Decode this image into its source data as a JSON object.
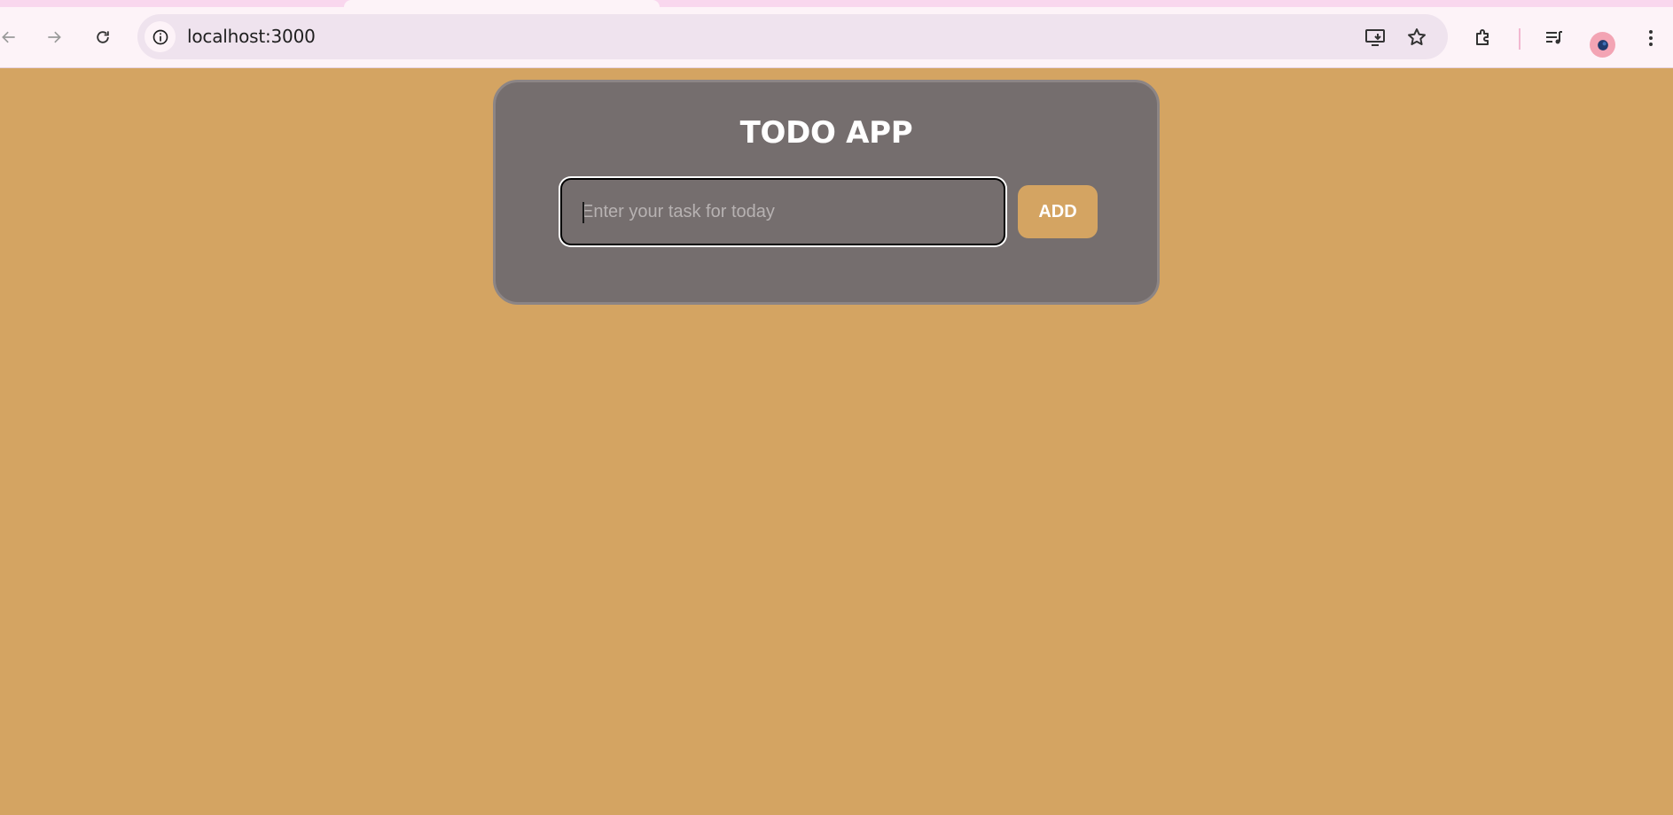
{
  "browser": {
    "url": "localhost:3000",
    "icons": {
      "back": "arrow-left-icon",
      "forward": "arrow-right-icon",
      "reload": "reload-icon",
      "site_info": "info-icon",
      "install": "install-app-icon",
      "bookmark": "star-icon",
      "extensions": "puzzle-icon",
      "media": "media-controls-icon",
      "profile": "profile-avatar",
      "menu": "kebab-menu-icon"
    }
  },
  "app": {
    "title": "TODO APP",
    "input": {
      "placeholder": "Enter your task for today",
      "value": ""
    },
    "add_label": "ADD"
  },
  "colors": {
    "page_background": "#d4a462",
    "card_background": "#756e6e",
    "button_background": "#d4a462",
    "text": "#ffffff"
  }
}
